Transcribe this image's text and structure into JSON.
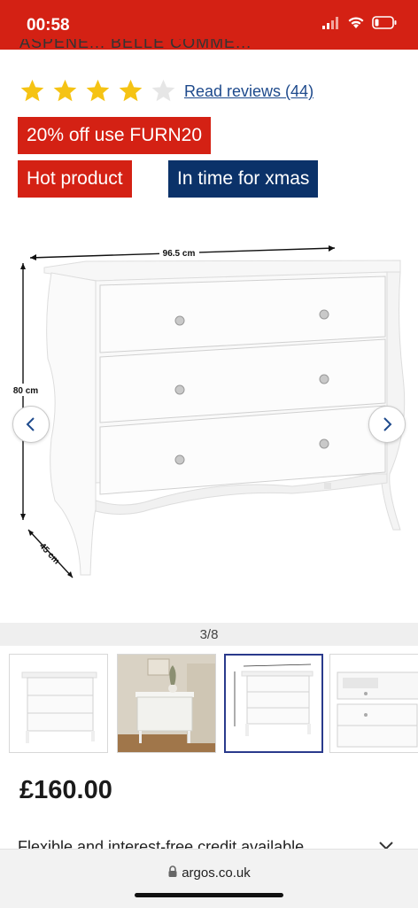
{
  "status_bar": {
    "time": "00:58",
    "bg_color": "#d42114",
    "icons": [
      "cellular-signal-icon",
      "wifi-icon",
      "battery-low-icon"
    ]
  },
  "product": {
    "title_partial": "ASPENE... BELLE COMME...",
    "rating": {
      "value": 4,
      "max": 5,
      "reviews_label": "Read reviews (44)"
    },
    "badges": [
      {
        "label": "20% off use FURN20",
        "color": "#d42114"
      },
      {
        "label": "Hot product",
        "color": "#d42114"
      },
      {
        "label": "In time for xmas",
        "color": "#0b3269"
      }
    ],
    "price": "£160.00",
    "credit_text": "Flexible and interest-free credit available"
  },
  "gallery": {
    "image_subject": "white 3-drawer chest with dimensions",
    "dimensions": {
      "width": "96.5 cm",
      "height": "80 cm",
      "depth": "45 cm"
    },
    "counter": "3/8",
    "prev_icon": "chevron-left-icon",
    "next_icon": "chevron-right-icon",
    "thumbnails_count_visible": 4,
    "active_thumbnail": 3
  },
  "browser": {
    "url": "argos.co.uk",
    "lock_icon": "lock-icon"
  }
}
